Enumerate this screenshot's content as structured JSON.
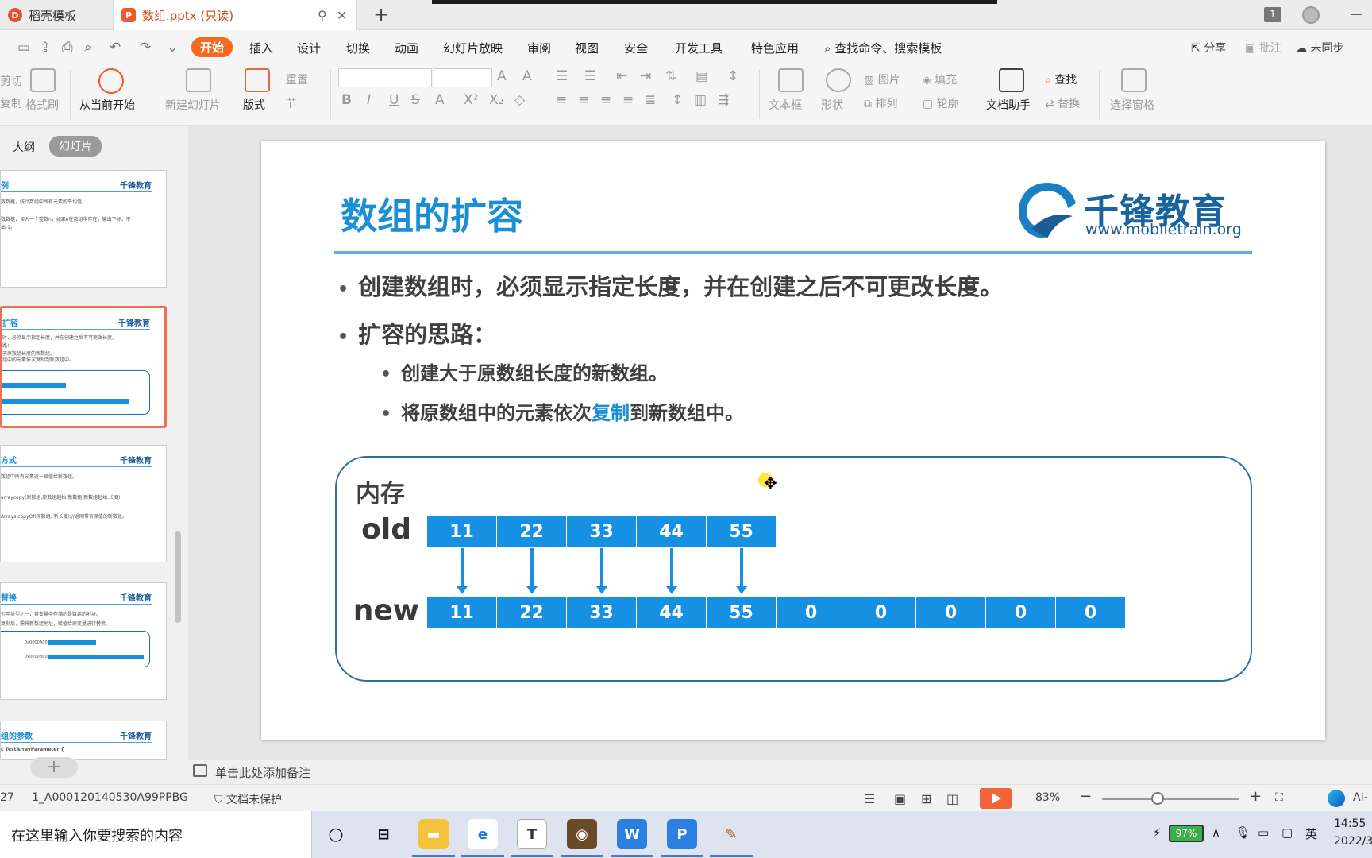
{
  "tabs": [
    {
      "label": "稻壳模板",
      "icon": "docer-icon"
    },
    {
      "label": "数组.pptx (只读)",
      "icon": "ppt-file-icon"
    }
  ],
  "window": {
    "count": "1"
  },
  "menu": {
    "items": [
      "开始",
      "插入",
      "设计",
      "切换",
      "动画",
      "幻灯片放映",
      "审阅",
      "视图",
      "安全",
      "开发工具",
      "特色应用"
    ],
    "active": "开始",
    "search": "查找命令、搜索模板",
    "share": "分享",
    "comment": "批注",
    "sync": "未同步"
  },
  "ribbon": {
    "cut": "剪切",
    "copy": "复制",
    "format_painter": "格式刷",
    "from_current": "从当前开始",
    "new_slide": "新建幻灯片",
    "layout": "版式",
    "reset": "重置",
    "section": "节",
    "textbox": "文本框",
    "shape": "形状",
    "picture": "图片",
    "fill": "填充",
    "arrange": "排列",
    "outline": "轮廓",
    "doc_assistant": "文档助手",
    "find": "查找",
    "replace": "替换",
    "select_pane": "选择窗格"
  },
  "panel": {
    "outline_tab": "大纲",
    "slides_tab": "幻灯片"
  },
  "thumbs": [
    {
      "title": "例",
      "logo": "千锋教育",
      "lines": [
        "数数据，统计数组中所有元素的平均值。",
        "数数据，读入一个整数n，如果n在数组中存在，输出下标，不",
        "出-1。"
      ]
    },
    {
      "title": "扩容",
      "logo": "千锋教育",
      "lines": [
        "时，必须显示指定长度，并在创建之后不可更改长度。",
        "路：",
        "于原数组长度的新数组。",
        "组中的元素依次复制到新数组中。"
      ]
    },
    {
      "title": "方式",
      "logo": "千锋教育",
      "lines": [
        "数组中所有元素逐一赋值给新数组。",
        "arraycopy(原数组,原数组起始,新数组,新数组起始,长度);",
        "Arrays.copyOf(原数组, 新长度);//返回带有原值的新数组。"
      ]
    },
    {
      "title": "替换",
      "logo": "千锋教育",
      "lines": [
        "引用类型之一，其变量中存储的是数组的地址。",
        "复制后，需将新数组地址，赋值给原变量进行替换。",
        "0x0000A001",
        "0x0000B002"
      ]
    },
    {
      "title": "组的参数",
      "logo": "千锋教育",
      "lines": [
        "c TestArrayParameter {"
      ]
    }
  ],
  "slide": {
    "title": "数组的扩容",
    "logo_cn": "千锋教育",
    "logo_url": "www.mobiletrain.org",
    "bullet1": "创建数组时，必须显示指定长度，并在创建之后不可更改长度。",
    "bullet2": "扩容的思路：",
    "sub1": "创建大于原数组长度的新数组。",
    "sub2_before": "将原数组中的元素依次",
    "sub2_highlight": "复制",
    "sub2_after": "到新数组中。",
    "memory_label": "内存",
    "old_label": "old",
    "new_label": "new",
    "old_values": [
      "11",
      "22",
      "33",
      "44",
      "55"
    ],
    "new_values": [
      "11",
      "22",
      "33",
      "44",
      "55",
      "0",
      "0",
      "0",
      "0",
      "0"
    ]
  },
  "notes": {
    "placeholder": "单击此处添加备注"
  },
  "status": {
    "slide_num": "27",
    "file_id": "1_A000120140530A99PPBG",
    "protection": "文档未保护",
    "zoom": "83%",
    "ai": "AI-"
  },
  "taskbar": {
    "search_placeholder": "在这里输入你要搜索的内容",
    "battery": "97%",
    "ime": "英",
    "time": "14:55",
    "date": "2022/3"
  },
  "colors": {
    "accent": "#f56a23",
    "slide_blue": "#1590e2",
    "title_blue": "#1a8fd6",
    "selected_thumb": "#ef7054"
  }
}
